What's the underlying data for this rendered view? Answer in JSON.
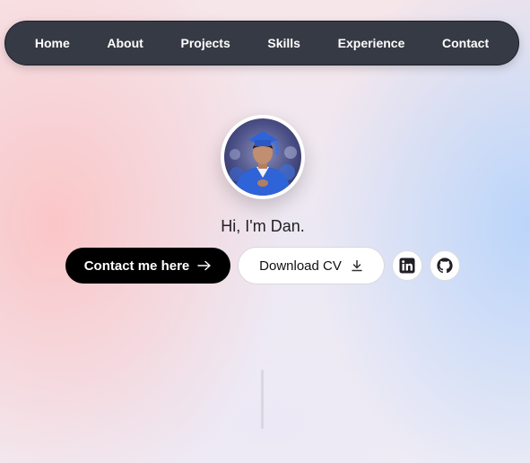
{
  "nav": {
    "items": [
      "Home",
      "About",
      "Projects",
      "Skills",
      "Experience",
      "Contact"
    ]
  },
  "hero": {
    "greeting": "Hi, I'm Dan.",
    "contact_label": "Contact me here",
    "download_label": "Download CV"
  },
  "social": {
    "icons": [
      "linkedin-icon",
      "github-icon"
    ]
  },
  "colors": {
    "nav_bg": "#363a45",
    "primary_button": "#000000",
    "avatar_robe": "#2f63d8"
  }
}
